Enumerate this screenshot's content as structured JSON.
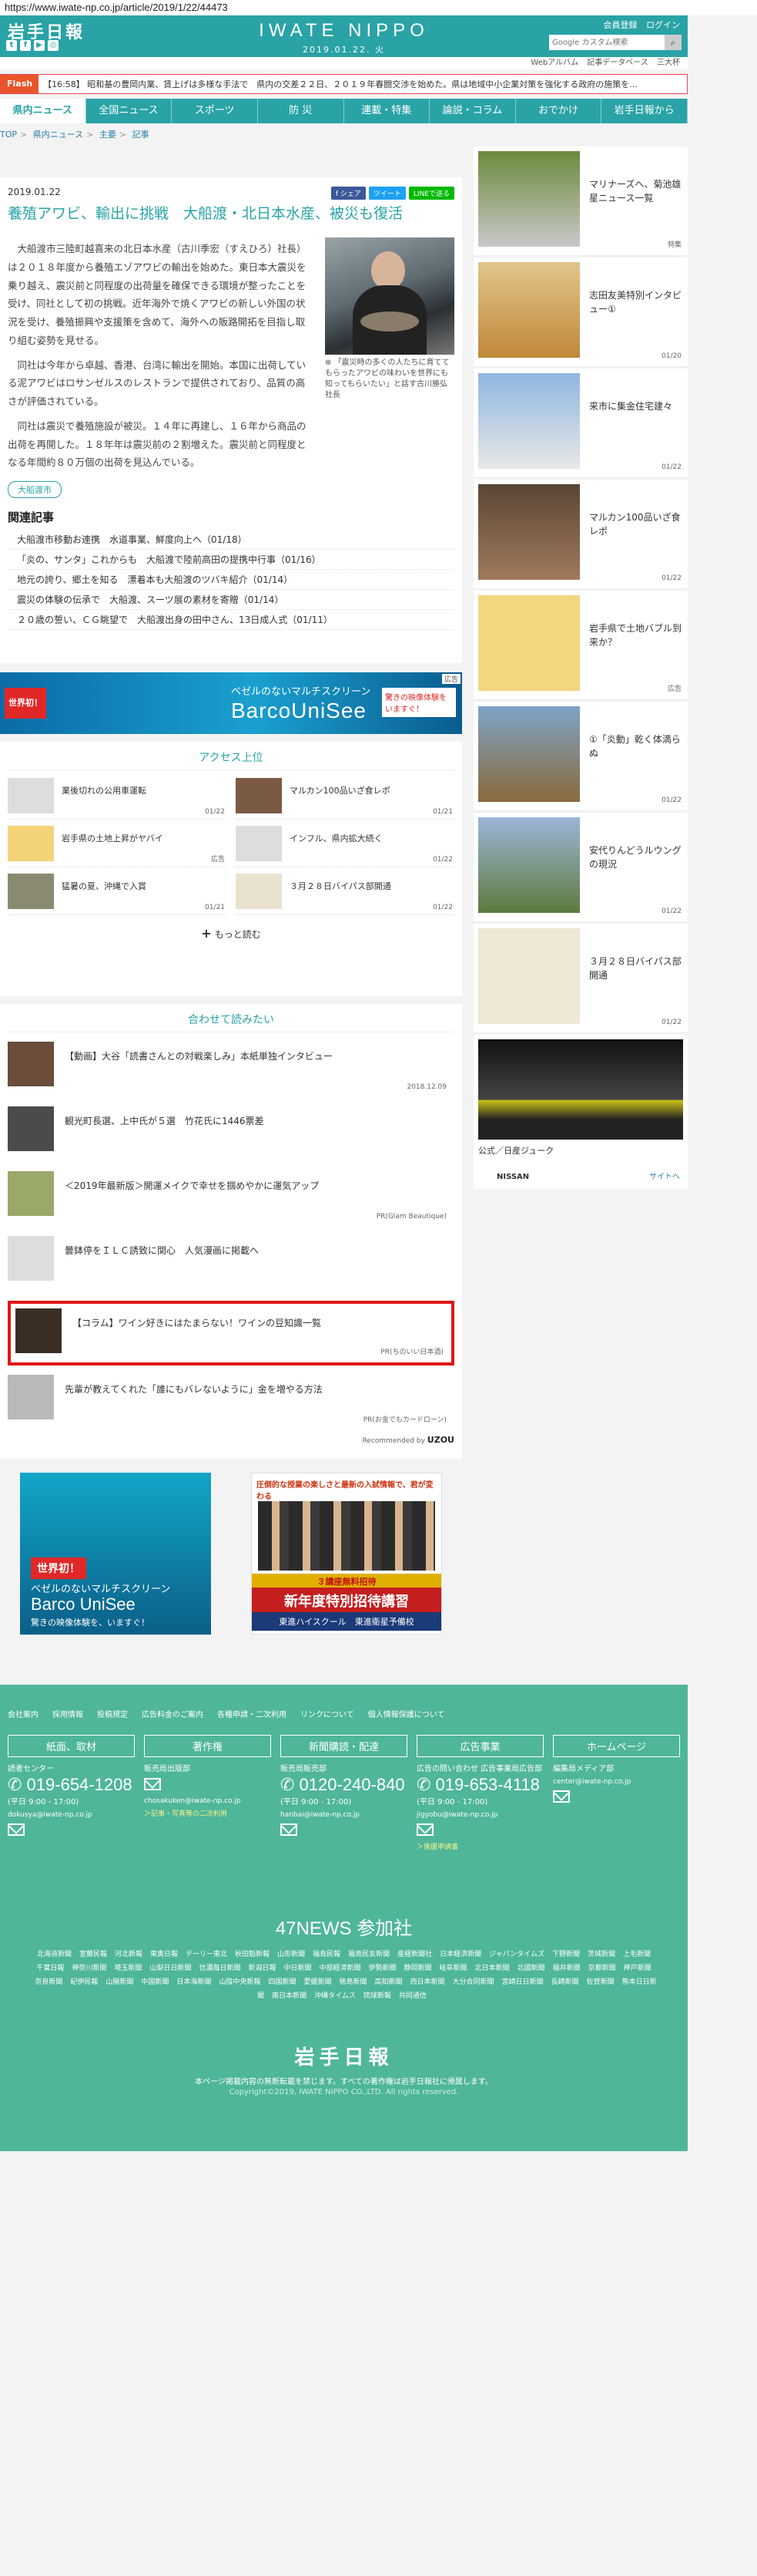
{
  "browser": {
    "url": "https://www.iwate-np.co.jp/article/2019/1/22/44473"
  },
  "header": {
    "logo_jp": "岩手日報",
    "brand": "IWATE NIPPO",
    "date": "2019.01.22. 火",
    "member_links": [
      "会員登録",
      "ログイン"
    ],
    "search_placeholder": "Google カスタム検索",
    "search_icon": "magnifier-icon",
    "sublinks": [
      "Webアルバム",
      "記事データベース",
      "三大杯"
    ],
    "social_icons": [
      "twitter-icon",
      "facebook-icon",
      "youtube-icon",
      "instagram-icon"
    ]
  },
  "flash": {
    "tag": "Flash",
    "text": "【16:58】 昭和基の豊岡内業、賃上げは多様な手法で　県内の交差２２日、２０１９年春闘交渉を始めた。県は地域中小企業対策を強化する政府の施策を..."
  },
  "nav": [
    "県内ニュース",
    "全国ニュース",
    "スポーツ",
    "防 災",
    "連載・特集",
    "論説・コラム",
    "おでかけ",
    "岩手日報から"
  ],
  "breadcrumb": [
    "TOP",
    "県内ニュース",
    "主要",
    "記事"
  ],
  "article": {
    "date": "2019.01.22",
    "share": [
      "f シェア",
      "ツイート",
      "LINEで送る"
    ],
    "title": "養殖アワビ、輸出に挑戦　大船渡・北日本水産、被災も復活",
    "photo_caption": "「震災時の多くの人たちに育ててもらったアワビの味わいを世界にも知ってもらいたい」と話す古川勝弘社長",
    "paragraphs": [
      "大船渡市三陸町越喜来の北日本水産（古川季宏（すえひろ）社長）は２０１８年度から養殖エゾアワビの輸出を始めた。東日本大震災を乗り越え、震災前と同程度の出荷量を確保できる環境が整ったことを受け、同社として初の挑戦。近年海外で焼くアワビの新しい外国の状況を受け、養殖振興や支援策を含めて、海外への販路開拓を目指し取り組む姿勢を見せる。",
      "同社は今年から卓越、香港、台湾に輸出を開始。本国に出荷している泥アワビはロサンゼルスのレストランで提供されており、品質の高さが評価されている。",
      "同社は震災で養殖施設が被災。１４年に再建し、１６年から商品の出荷を再開した。１８年年は震災前の２割増えた。震災前と同程度となる年間約８０万個の出荷を見込んでいる。"
    ],
    "tag": "大船渡市"
  },
  "related": {
    "heading": "関連記事",
    "items": [
      "大船渡市移動お連携　水道事業、鮮度向上へ（01/18）",
      "「炎の、サンタ」これからも　大船渡で陸前高田の提携中行事（01/16）",
      "地元の誇り、郷土を知る　漂着本も大船渡のツバキ紹介（01/14）",
      "震災の体験の伝承で　大船渡、スーツ展の素材を寄贈（01/14）",
      "２０歳の誓い、ＣＧ眺望で　大船渡出身の田中さん、13日成人式（01/11）"
    ]
  },
  "banner_ad": {
    "badge": "世界初！",
    "line1": "ベゼルのないマルチスクリーン",
    "line2": "BarcoUniSee",
    "cta": "驚きの映像体験をいますぐ！",
    "ad_label": "広告"
  },
  "ranking": {
    "heading": "アクセス上位",
    "items": [
      {
        "title": "業後切れの公用車運転",
        "date": "01/22",
        "icon": "no-image-icon"
      },
      {
        "title": "マルカン100品いざ食レポ",
        "date": "01/21",
        "icon": "photo-thumb"
      },
      {
        "title": "岩手県の土地上昇がヤバイ",
        "date": "広告",
        "icon": "map-thumb"
      },
      {
        "title": "インフル、県内拡大続く",
        "date": "01/22",
        "icon": "no-image-icon"
      },
      {
        "title": "猛暑の夏、沖縄で入賞",
        "date": "01/21",
        "icon": "photo-thumb"
      },
      {
        "title": "３月２８日バイパス部開通",
        "date": "01/22",
        "icon": "map-thumb"
      }
    ],
    "more": "もっと読む"
  },
  "recommend": {
    "heading": "合わせて読みたい",
    "items": [
      {
        "title": "【動画】大谷「読書さんとの対戦楽しみ」本紙単独インタビュー",
        "source": "2018.12.09"
      },
      {
        "title": "観光町長選、上中氏が５選　竹花氏に1446票差",
        "source": ""
      },
      {
        "title": "＜2019年最新版＞開運メイクで幸せを掴めやかに運気アップ",
        "source": "PR(Glam Beautique)"
      },
      {
        "title": "曇鉢停をＩＬＣ誘致に関心　人気漫画に掲載へ",
        "source": ""
      },
      {
        "title": "【コラム】ワイン好きにはたまらない！ワインの豆知識一覧",
        "source": "PR(ちのいい日本酒)"
      },
      {
        "title": "先輩が教えてくれた「誰にもバレないように」金を増やる方法",
        "source": "PR(お金でもカードローン)"
      }
    ],
    "recommended_by": "Recommended by",
    "uzou": "UZOU"
  },
  "bottom_ads": {
    "left": {
      "badge": "世界初！",
      "line1": "ベゼルのないマルチスクリーン",
      "line2": "Barco UniSee",
      "line3": "驚きの映像体験を、いますぐ！"
    },
    "right": {
      "top": "圧倒的な授業の楽しさと最新の入試情報で、君が変わる",
      "band": "３講座無料招待",
      "big": "新年度特別招待講習",
      "school": "東進ハイスクール　東進衛星予備校"
    }
  },
  "sidebar": {
    "items": [
      {
        "title": "マリナーズへ、菊池雄星ニュース一覧",
        "date": "特集"
      },
      {
        "title": "志田友美特別インタビュー①",
        "date": "01/20"
      },
      {
        "title": "来市に集金住宅建々",
        "date": "01/22"
      },
      {
        "title": "マルカン100品いざ食レポ",
        "date": "01/22"
      },
      {
        "title": "岩手県で土地バブル到来か？",
        "date": "広告"
      },
      {
        "title": "①「炎動」乾く体満らぬ",
        "date": "01/22"
      },
      {
        "title": "安代りんどうルウングの現況",
        "date": "01/22"
      },
      {
        "title": "３月２８日バイパス部開通",
        "date": "01/22"
      }
    ],
    "ad": {
      "title": "公式／日産ジューク",
      "brand": "NISSAN",
      "site": "サイトへ"
    }
  },
  "footer": {
    "links": [
      "会社案内",
      "採用情報",
      "投稿規定",
      "広告料金のご案内",
      "各種申請・二次利用",
      "リンクについて",
      "個人情報保護について"
    ],
    "cols": [
      {
        "heading": "紙面、取材",
        "sub": "読者センター",
        "tel": "019-654-1208",
        "hours": "(平日 9:00 - 17:00)",
        "mail": "dokusya@iwate-np.co.jp",
        "note": ""
      },
      {
        "heading": "著作権",
        "sub": "販売局出版部",
        "tel": "",
        "hours": "",
        "mail": "chosakuken@iwate-np.co.jp",
        "note": "＞記事・写真等の二次利用"
      },
      {
        "heading": "新聞購読・配達",
        "sub": "販売局販売部",
        "tel": "0120-240-840",
        "hours": "(平日 9:00 - 17:00)",
        "mail": "hanbai@iwate-np.co.jp",
        "note": ""
      },
      {
        "heading": "広告事業",
        "sub": "広告の問い合わせ 広告事業局広告部",
        "tel": "019-653-4118",
        "hours": "(平日 9:00 - 17:00)",
        "mail": "jigyobu@iwate-np.co.jp",
        "note": "＞後援申請書"
      },
      {
        "heading": "ホームページ",
        "sub": "編集局メディア部",
        "tel": "",
        "hours": "",
        "mail": "center@iwate-np.co.jp",
        "note": ""
      }
    ],
    "news47": "47NEWS 参加社",
    "papers": [
      "北海道新聞",
      "室蘭民報",
      "河北新報",
      "東奥日報",
      "デーリー東北",
      "秋田魁新報",
      "山形新聞",
      "福島民報",
      "福島民友新聞",
      "産経新聞社",
      "日本経済新聞",
      "ジャパンタイムズ",
      "下野新聞",
      "茨城新聞",
      "上毛新聞",
      "千葉日報",
      "神奈川新聞",
      "埼玉新聞",
      "山梨日日新聞",
      "信濃毎日新聞",
      "新潟日報",
      "中日新聞",
      "中部経済新聞",
      "伊勢新聞",
      "静岡新聞",
      "岐阜新聞",
      "北日本新聞",
      "北國新聞",
      "福井新聞",
      "京都新聞",
      "神戸新聞",
      "奈良新聞",
      "紀伊民報",
      "山陽新聞",
      "中国新聞",
      "日本海新聞",
      "山陰中央新報",
      "四国新聞",
      "愛媛新聞",
      "徳島新聞",
      "高知新聞",
      "西日本新聞",
      "大分合同新聞",
      "宮崎日日新聞",
      "長崎新聞",
      "佐賀新聞",
      "熊本日日新聞",
      "南日本新聞",
      "沖縄タイムス",
      "琉球新報",
      "共同通信"
    ],
    "logo": "岩手日報",
    "notice": "本ページ掲載内容の無断転載を禁じます。すべての著作権は岩手日報社に帰属します。",
    "copyright": "Copyright©2019, IWATE NIPPO CO.,LTD. All rights reserved."
  }
}
